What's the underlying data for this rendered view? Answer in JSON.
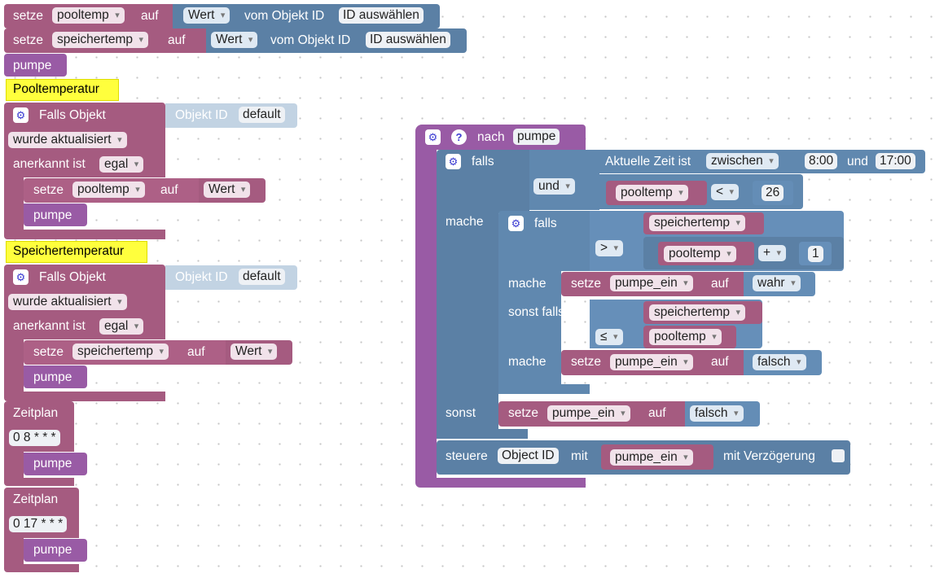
{
  "colors": {
    "variable": "#a55b80",
    "procedure": "#995ba5",
    "logic": "#5b80a5",
    "comment": "#ffff3d",
    "canvas_dots": "#c6c6c6"
  },
  "icons": {
    "gear": "gear-icon",
    "help": "help-icon",
    "dropdown": "chevron-down-icon"
  },
  "set1": {
    "label": "setze",
    "var": "pooltemp",
    "auf": "auf",
    "prop": "Wert",
    "vom": "vom Objekt ID",
    "id": "ID auswählen"
  },
  "set2": {
    "label": "setze",
    "var": "speichertemp",
    "auf": "auf",
    "prop": "Wert",
    "vom": "vom Objekt ID",
    "id": "ID auswählen"
  },
  "call_pumpe": "pumpe",
  "trigger1": {
    "comment": "Pooltemperatur",
    "falls": "Falls Objekt",
    "oid_label": "Objekt ID",
    "oid": "default",
    "updated": "wurde aktualisiert",
    "ack_label": "anerkannt ist",
    "ack": "egal",
    "setze": "setze",
    "var": "pooltemp",
    "auf": "auf",
    "val": "Wert",
    "call": "pumpe"
  },
  "trigger2": {
    "comment": "Speichertemperatur",
    "falls": "Falls Objekt",
    "oid_label": "Objekt ID",
    "oid": "default",
    "updated": "wurde aktualisiert",
    "ack_label": "anerkannt ist",
    "ack": "egal",
    "setze": "setze",
    "var": "speichertemp",
    "auf": "auf",
    "val": "Wert",
    "call": "pumpe"
  },
  "sched1": {
    "label": "Zeitplan",
    "cron": "0 8 * * *",
    "call": "pumpe"
  },
  "sched2": {
    "label": "Zeitplan",
    "cron": "0 17 * * *",
    "call": "pumpe"
  },
  "proc": {
    "nach": "nach",
    "name": "pumpe",
    "falls": "falls",
    "mache": "mache",
    "sonst": "sonst",
    "sonst_falls": "sonst falls",
    "time_label": "Aktuelle Zeit ist",
    "time_mode": "zwischen",
    "time_from": "8:00",
    "und": "und",
    "time_to": "17:00",
    "logic_op": "und",
    "cmp_var": "pooltemp",
    "cmp_op": "<",
    "cmp_val": "26",
    "inner": {
      "var1": "speichertemp",
      "op": ">",
      "var2": "pooltemp",
      "arith": "+",
      "num": "1",
      "setze": "setze",
      "target": "pumpe_ein",
      "auf": "auf",
      "val_true": "wahr",
      "var3": "speichertemp",
      "op2": "≤",
      "var4": "pooltemp",
      "val_false": "falsch"
    },
    "else_setze": "setze",
    "else_target": "pumpe_ein",
    "else_auf": "auf",
    "else_val": "falsch",
    "control": "steuere",
    "control_oid": "Object ID",
    "control_mit": "mit",
    "control_var": "pumpe_ein",
    "control_delay": "mit Verzögerung"
  }
}
